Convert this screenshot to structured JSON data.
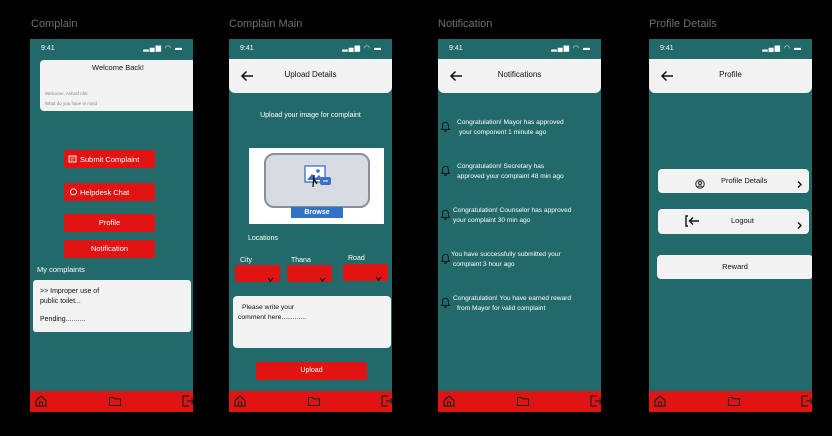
{
  "frames": {
    "complain": "Complain",
    "complain_main": "Complain Main",
    "notification": "Notification",
    "profile_details": "Profile Details"
  },
  "status": {
    "time": "9:41",
    "icons": "signal-wifi-battery-icons"
  },
  "colors": {
    "background": "#226a69",
    "accent": "#e11414",
    "card": "#f2f2f2"
  },
  "complain": {
    "welcome": "Welcome  Back!",
    "welcome_sub": "Welcome, Ashraf Abir",
    "welcome_placeholder": "What do you have in mind",
    "buttons": [
      "Submit Complaint",
      "Helpdesk Chat",
      "Profile",
      "Notification"
    ],
    "my_complaints_title": "My complaints",
    "complaint_line1": ">> Improper use of",
    "complaint_line2": "public toilet...",
    "complaint_status": "Pending..........",
    "icons": [
      "submit-complaint-icon",
      "chat-icon"
    ]
  },
  "upload": {
    "title": "Upload Details",
    "instruction": "Upload your image for complaint",
    "browse": "Browse",
    "locations": "Locations",
    "city": "City",
    "thana": "Thana",
    "road": "Road",
    "comment_placeholder_1": "Please write your",
    "comment_placeholder_2": "comment here.............",
    "upload_button": "Upload"
  },
  "notifications": {
    "title": "Notifications",
    "items": [
      [
        "Congratulation! Mayor has approved",
        "your component 1 minute ago"
      ],
      [
        "Congratulation! Secretary has",
        "approved your  complaint 48 min ago"
      ],
      [
        "Congratulation! Counselor has approved",
        "your complaint 30 min ago"
      ],
      [
        "You have successfully submitted your",
        "complaint 3 hour ago"
      ],
      [
        "Congratulation! You have earned reward",
        "from Mayor for  valid complaint"
      ]
    ]
  },
  "profile": {
    "title": "Profile",
    "profile_details": "Profile Details",
    "logout": "Logout",
    "reward": "Reward"
  },
  "bottom_nav": [
    "home-icon",
    "folder-icon",
    "logout-icon"
  ]
}
